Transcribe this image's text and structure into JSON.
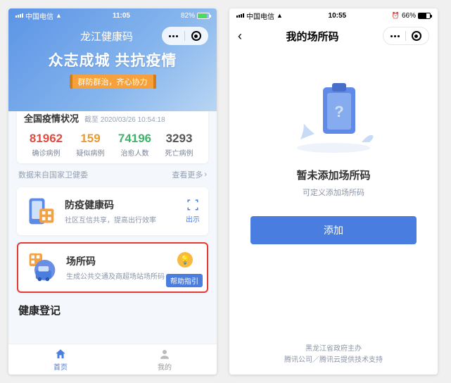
{
  "left": {
    "status": {
      "carrier": "中国电信",
      "time": "11:05",
      "battery": "82%"
    },
    "app_title": "龙江健康码",
    "hero_main": "众志成城 共抗疫情",
    "hero_tag": "群防群治，齐心协力",
    "stats": {
      "title": "全国疫情状况",
      "asof_prefix": "截至",
      "asof": "2020/03/26 10:54:18",
      "items": [
        {
          "num": "81962",
          "label": "确诊病例",
          "cls": "c-red"
        },
        {
          "num": "159",
          "label": "疑似病例",
          "cls": "c-orange"
        },
        {
          "num": "74196",
          "label": "治愈人数",
          "cls": "c-green"
        },
        {
          "num": "3293",
          "label": "死亡病例",
          "cls": "c-dark"
        }
      ]
    },
    "source_text": "数据来自国家卫健委",
    "more_text": "查看更多",
    "card_health": {
      "title": "防疫健康码",
      "sub": "社区互信共享，提高出行效率",
      "show": "出示"
    },
    "card_venue": {
      "title": "场所码",
      "sub": "生成公共交通及商超场站场所码",
      "help": "帮助指引"
    },
    "section_title": "健康登记",
    "tabs": {
      "home": "首页",
      "mine": "我的"
    }
  },
  "right": {
    "status": {
      "carrier": "中国电信",
      "time": "10:55",
      "battery": "66%"
    },
    "nav_title": "我的场所码",
    "empty_main": "暂未添加场所码",
    "empty_sub": "可定义添加场所码",
    "add_button": "添加",
    "footer_line1": "黑龙江省政府主办",
    "footer_line2": "腾讯公司／腾讯云提供技术支持"
  }
}
